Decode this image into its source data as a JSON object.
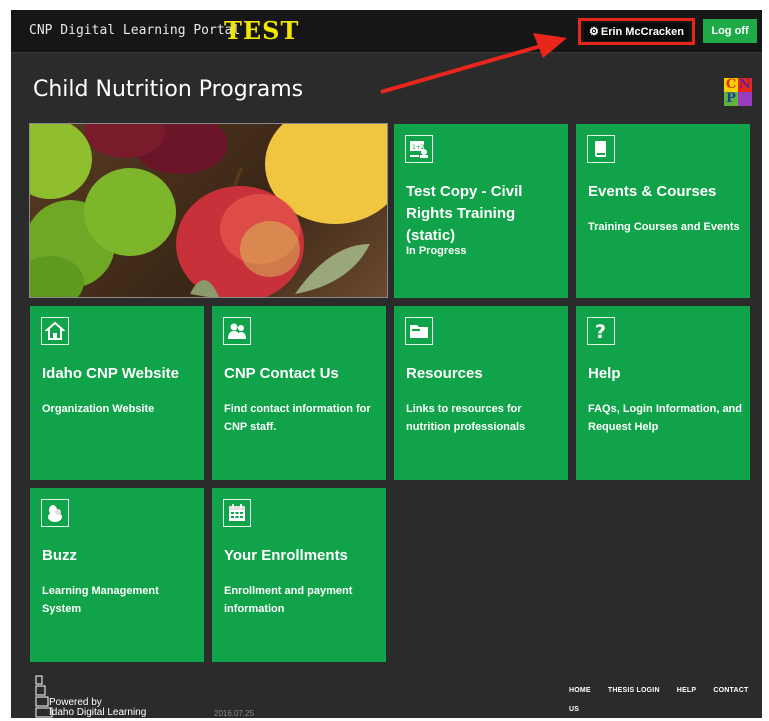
{
  "header": {
    "portal_title": "CNP Digital Learning Portal",
    "env_label": "TEST",
    "user_name": "Erin McCracken",
    "logoff_label": "Log off"
  },
  "page": {
    "title": "Child Nutrition Programs",
    "logo_letters": [
      "C",
      "N",
      "P"
    ]
  },
  "tiles": [
    {
      "icon": "classroom-icon",
      "title": "Test Copy - Civil Rights Training (static)",
      "desc": "In Progress"
    },
    {
      "icon": "book-icon",
      "title": "Events & Courses",
      "desc": "Training Courses and Events"
    },
    {
      "icon": "home-icon",
      "title": "Idaho CNP Website",
      "desc": "Organization Website"
    },
    {
      "icon": "people-icon",
      "title": "CNP Contact Us",
      "desc": "Find contact information for CNP staff."
    },
    {
      "icon": "folder-icon",
      "title": "Resources",
      "desc": "Links to resources for nutrition professionals"
    },
    {
      "icon": "question-icon",
      "title": "Help",
      "desc": "FAQs, Login Information, and Request Help"
    },
    {
      "icon": "buzz-icon",
      "title": "Buzz",
      "desc": "Learning Management System"
    },
    {
      "icon": "calendar-icon",
      "title": "Your Enrollments",
      "desc": "Enrollment and payment information"
    }
  ],
  "footer": {
    "powered_line1": "Powered by",
    "powered_line2": "Idaho Digital Learning",
    "version": "2016.07.25",
    "links": [
      "HOME",
      "THESIS LOGIN",
      "HELP",
      "CONTACT US"
    ]
  },
  "colors": {
    "tile_green": "#10a349",
    "logoff_green": "#1eaa46",
    "highlight_red": "#e8261c",
    "test_yellow": "#f2e600",
    "background": "#2b2b2b"
  }
}
